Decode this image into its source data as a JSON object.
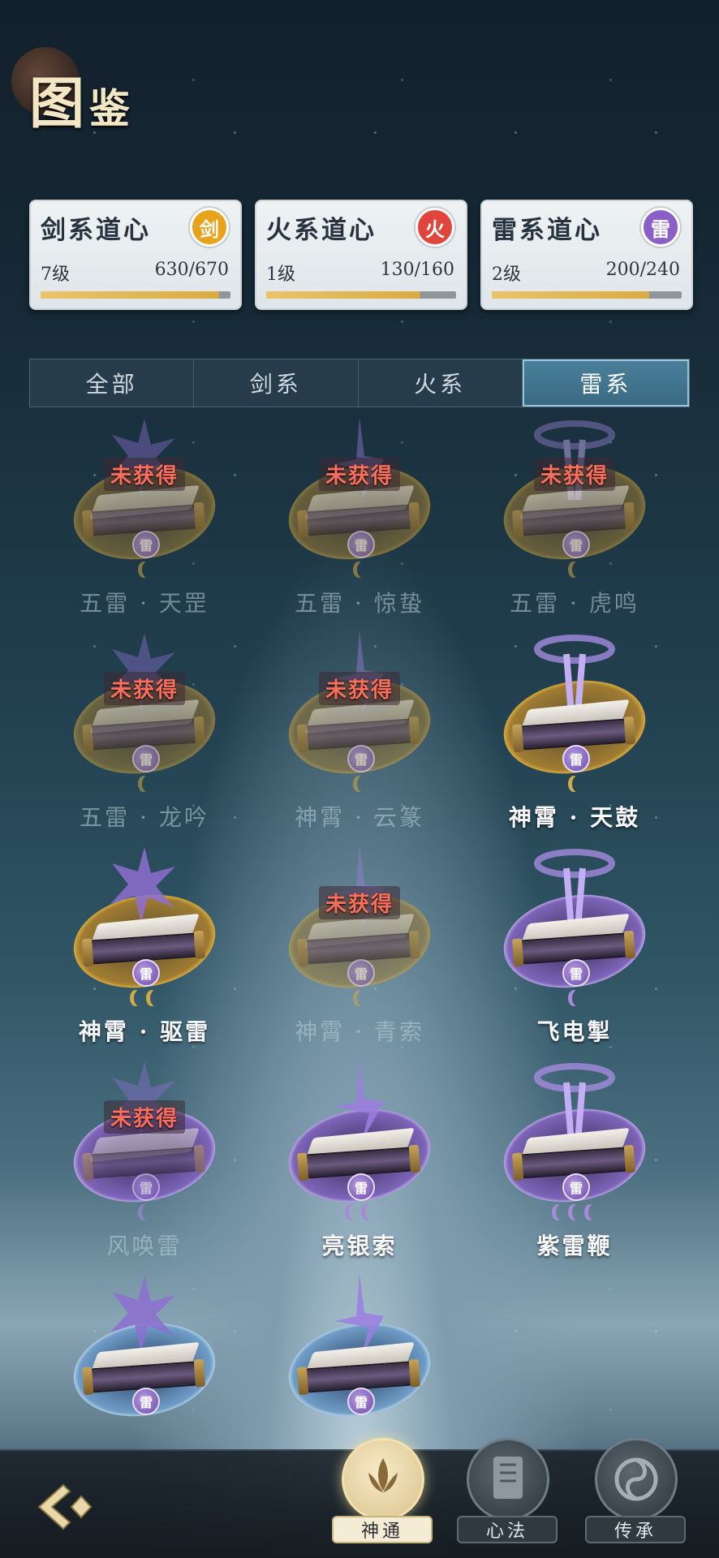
{
  "header": {
    "title_main": "图",
    "title_rest": "鉴"
  },
  "dao_cards": [
    {
      "title": "剑系道心",
      "icon": "sword-emblem-icon",
      "emblem_glyph": "剑",
      "color": "#e8a21c",
      "level": "7级",
      "progress": "630/670",
      "fraction": 0.94
    },
    {
      "title": "火系道心",
      "icon": "fire-emblem-icon",
      "emblem_glyph": "火",
      "color": "#e0443a",
      "level": "1级",
      "progress": "130/160",
      "fraction": 0.81
    },
    {
      "title": "雷系道心",
      "icon": "thunder-emblem-icon",
      "emblem_glyph": "雷",
      "color": "#8a5fc8",
      "level": "2级",
      "progress": "200/240",
      "fraction": 0.83
    }
  ],
  "tabs": [
    {
      "label": "全部",
      "active": false
    },
    {
      "label": "剑系",
      "active": false
    },
    {
      "label": "火系",
      "active": false
    },
    {
      "label": "雷系",
      "active": true
    }
  ],
  "locked_label": "未获得",
  "element_glyph": "雷",
  "items": [
    {
      "name": "五雷 · 天罡",
      "locked": true,
      "disc": "gold",
      "moons": 1,
      "moon_color": "gold"
    },
    {
      "name": "五雷 · 惊蛰",
      "locked": true,
      "disc": "gold",
      "moons": 1,
      "moon_color": "gold"
    },
    {
      "name": "五雷 · 虎鸣",
      "locked": true,
      "disc": "gold",
      "moons": 1,
      "moon_color": "gold"
    },
    {
      "name": "五雷 · 龙吟",
      "locked": true,
      "disc": "gold",
      "moons": 1,
      "moon_color": "gold"
    },
    {
      "name": "神霄 · 云篆",
      "locked": true,
      "disc": "gold",
      "moons": 1,
      "moon_color": "gold"
    },
    {
      "name": "神霄 · 天鼓",
      "locked": false,
      "disc": "gold",
      "moons": 1,
      "moon_color": "gold"
    },
    {
      "name": "神霄 · 驱雷",
      "locked": false,
      "disc": "gold",
      "moons": 2,
      "moon_color": "gold"
    },
    {
      "name": "神霄 · 青索",
      "locked": true,
      "disc": "gold",
      "moons": 1,
      "moon_color": "gold"
    },
    {
      "name": "飞电掣",
      "locked": false,
      "disc": "purple",
      "moons": 1,
      "moon_color": "purple"
    },
    {
      "name": "风唤雷",
      "locked": true,
      "disc": "purple",
      "moons": 1,
      "moon_color": "purple"
    },
    {
      "name": "亮银索",
      "locked": false,
      "disc": "purple",
      "moons": 2,
      "moon_color": "purple"
    },
    {
      "name": "紫雷鞭",
      "locked": false,
      "disc": "purple",
      "moons": 3,
      "moon_color": "purple"
    },
    {
      "name": "",
      "locked": false,
      "disc": "blue",
      "moons": 0,
      "moon_color": "purple"
    },
    {
      "name": "",
      "locked": false,
      "disc": "blue",
      "moons": 0,
      "moon_color": "purple"
    }
  ],
  "bottom_nav": {
    "back_icon": "back-arrow-icon",
    "buttons": [
      {
        "label": "神通",
        "icon": "lotus-icon",
        "active": true
      },
      {
        "label": "心法",
        "icon": "scroll-icon",
        "active": false
      },
      {
        "label": "传承",
        "icon": "swirl-icon",
        "active": false
      }
    ]
  }
}
